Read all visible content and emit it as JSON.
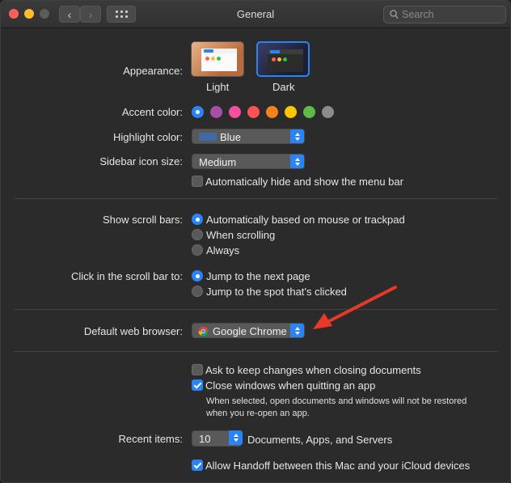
{
  "window": {
    "title": "General"
  },
  "toolbar": {
    "back_label": "‹",
    "forward_label": "›",
    "search_placeholder": "Search"
  },
  "appearance": {
    "label": "Appearance:",
    "options": [
      {
        "name": "Light",
        "selected": false
      },
      {
        "name": "Dark",
        "selected": true
      }
    ]
  },
  "accent": {
    "label": "Accent color:",
    "colors": [
      "#2b84f7",
      "#a550a7",
      "#f74f9e",
      "#fe5257",
      "#f7821b",
      "#ffc600",
      "#62ba46",
      "#8c8c8c"
    ],
    "selected": 0
  },
  "highlight": {
    "label": "Highlight color:",
    "value": "Blue",
    "color": "#3f6aa4"
  },
  "sidebar_icon": {
    "label": "Sidebar icon size:",
    "value": "Medium"
  },
  "menubar": {
    "label": "Automatically hide and show the menu bar",
    "checked": false
  },
  "scrollbars": {
    "label": "Show scroll bars:",
    "options": [
      "Automatically based on mouse or trackpad",
      "When scrolling",
      "Always"
    ],
    "selected": 0
  },
  "click_scrollbar": {
    "label": "Click in the scroll bar to:",
    "options": [
      "Jump to the next page",
      "Jump to the spot that’s clicked"
    ],
    "selected": 0
  },
  "browser": {
    "label": "Default web browser:",
    "value": "Google Chrome"
  },
  "documents": {
    "ask_keep": {
      "label": "Ask to keep changes when closing documents",
      "checked": false
    },
    "close_windows": {
      "label": "Close windows when quitting an app",
      "checked": true
    },
    "note": "When selected, open documents and windows will not be restored when you re-open an app."
  },
  "recent": {
    "label": "Recent items:",
    "value": "10",
    "suffix": "Documents, Apps, and Servers"
  },
  "handoff": {
    "label": "Allow Handoff between this Mac and your iCloud devices",
    "checked": true
  },
  "annotation_color": "#e8372b"
}
